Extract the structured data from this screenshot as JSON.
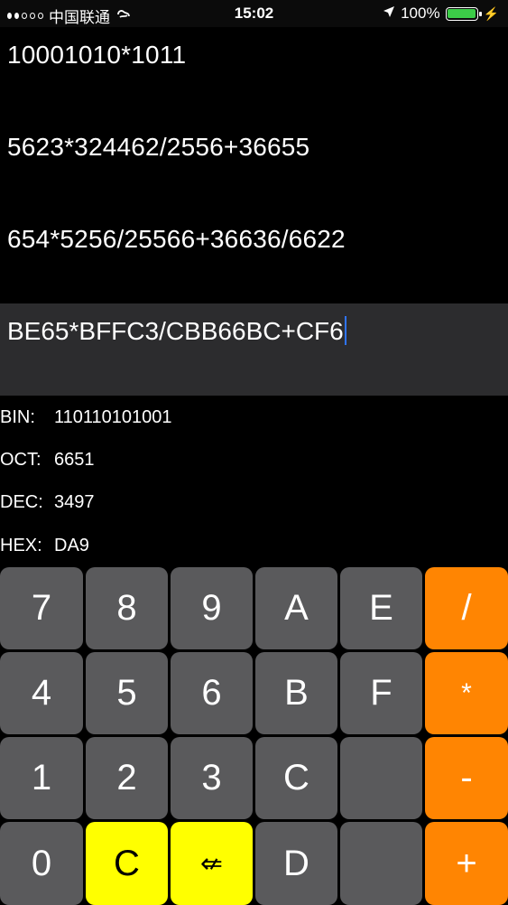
{
  "status_bar": {
    "carrier": "中国联通",
    "time": "15:02",
    "battery": "100%",
    "battery_level": 1.0
  },
  "history": [
    "10001010*1011",
    "5623*324462/2556+36655",
    "654*5256/25566+36636/6622"
  ],
  "input": "BE65*BFFC3/CBB66BC+CF6",
  "results": {
    "bin": {
      "label": "BIN:",
      "value": "110110101001"
    },
    "oct": {
      "label": "OCT:",
      "value": "6651"
    },
    "dec": {
      "label": "DEC:",
      "value": "3497"
    },
    "hex": {
      "label": "HEX:",
      "value": "DA9"
    }
  },
  "keys": {
    "r1": [
      "7",
      "8",
      "9",
      "A",
      "E",
      "/"
    ],
    "r2": [
      "4",
      "5",
      "6",
      "B",
      "F",
      "*"
    ],
    "r3": [
      "1",
      "2",
      "3",
      "C",
      "",
      "-"
    ],
    "r4": [
      "0",
      "C",
      "⇍",
      "D",
      "",
      "+"
    ]
  },
  "colors": {
    "operator": "#ff8502",
    "highlight": "#ffff00",
    "key": "#5a5a5c",
    "cursor": "#2f74ff"
  }
}
